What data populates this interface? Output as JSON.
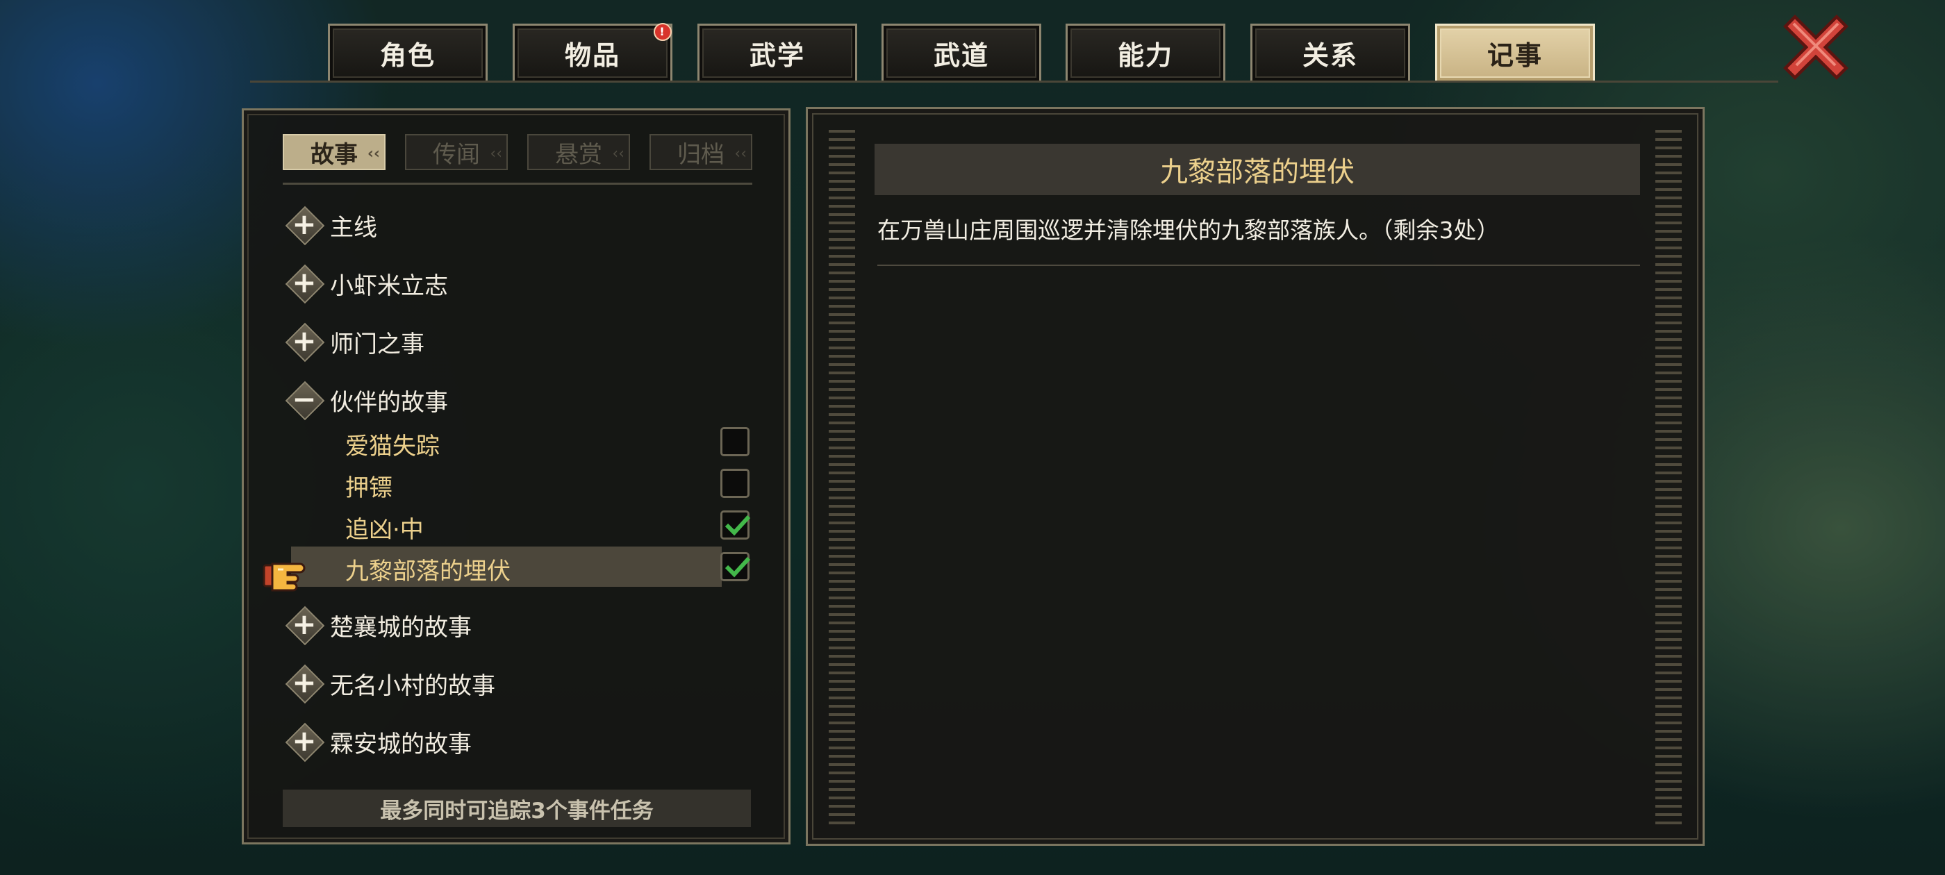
{
  "top_tabs": [
    {
      "label": "角色",
      "active": false,
      "badge": false
    },
    {
      "label": "物品",
      "active": false,
      "badge": true
    },
    {
      "label": "武学",
      "active": false,
      "badge": false
    },
    {
      "label": "武道",
      "active": false,
      "badge": false
    },
    {
      "label": "能力",
      "active": false,
      "badge": false
    },
    {
      "label": "关系",
      "active": false,
      "badge": false
    },
    {
      "label": "记事",
      "active": true,
      "badge": false
    }
  ],
  "badge_text": "!",
  "close_icon": "close-x-icon",
  "journal": {
    "sub_tabs": [
      {
        "label": "故事",
        "active": true
      },
      {
        "label": "传闻",
        "active": false
      },
      {
        "label": "悬赏",
        "active": false
      },
      {
        "label": "归档",
        "active": false
      }
    ],
    "categories": [
      {
        "label": "主线",
        "expanded": false
      },
      {
        "label": "小虾米立志",
        "expanded": false
      },
      {
        "label": "师门之事",
        "expanded": false
      },
      {
        "label": "伙伴的故事",
        "expanded": true
      },
      {
        "label": "楚襄城的故事",
        "expanded": false
      },
      {
        "label": "无名小村的故事",
        "expanded": false
      },
      {
        "label": "霖安城的故事",
        "expanded": false
      }
    ],
    "expand_symbol": "+",
    "collapse_symbol": "−",
    "partner_quests": [
      {
        "label": "爱猫失踪",
        "tracked": false,
        "selected": false
      },
      {
        "label": "押镖",
        "tracked": false,
        "selected": false
      },
      {
        "label": "追凶·中",
        "tracked": true,
        "selected": false
      },
      {
        "label": "九黎部落的埋伏",
        "tracked": true,
        "selected": true
      }
    ],
    "footer_note": "最多同时可追踪3个事件任务"
  },
  "detail": {
    "title": "九黎部落的埋伏",
    "description": "在万兽山庄周围巡逻并清除埋伏的九黎部落族人。（剩余3处）"
  },
  "colors": {
    "gold_text": "#ecd08c",
    "active_tab": "#d6c397",
    "check_green": "#43b84a"
  }
}
